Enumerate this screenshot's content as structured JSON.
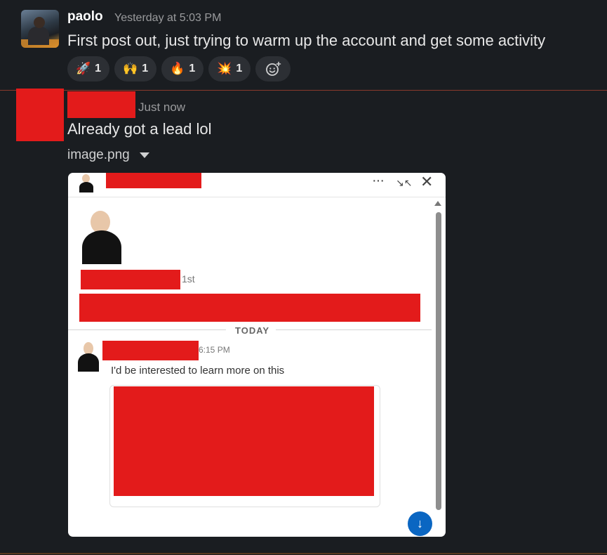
{
  "message1": {
    "author": "paolo",
    "timestamp": "Yesterday at 5:03 PM",
    "text": "First post out, just trying to warm up the account and get some activity",
    "reactions": [
      {
        "emoji": "🚀",
        "count": "1"
      },
      {
        "emoji": "🙌",
        "count": "1"
      },
      {
        "emoji": "🔥",
        "count": "1"
      },
      {
        "emoji": "💥",
        "count": "1"
      }
    ],
    "add_reaction_icon": "add-emoji-icon"
  },
  "message2": {
    "timestamp": "Just now",
    "text": "Already got a lead lol",
    "attachment_name": "image.png"
  },
  "screenshot": {
    "connection_degree": "1st",
    "divider_label": "TODAY",
    "message_time": "6:15 PM",
    "message_text": "I'd be interested to learn more on this",
    "more_glyph": "···",
    "collapse_glyph": "↘↖",
    "close_glyph": "✕",
    "scroll_down_glyph": "↓"
  },
  "colors": {
    "background": "#1a1d21",
    "redaction": "#e31b1b",
    "linkedin_blue": "#0a66c2"
  }
}
